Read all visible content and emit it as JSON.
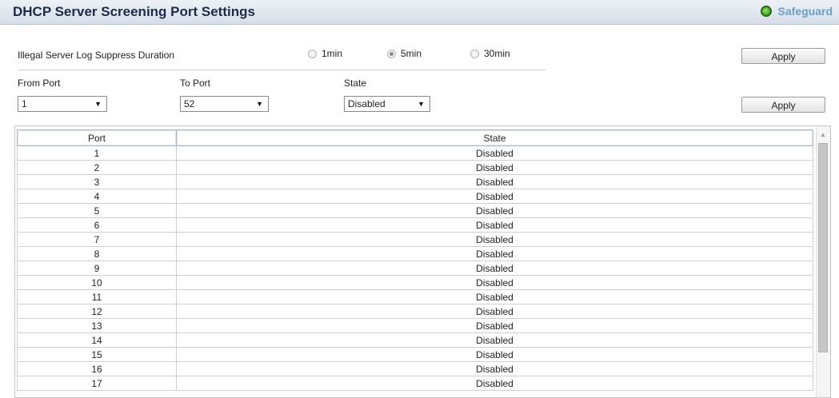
{
  "header": {
    "title": "DHCP Server Screening Port Settings",
    "safeguard_label": "Safeguard",
    "safeguard_icon": "status-dot-icon",
    "safeguard_color": "#2e8b12"
  },
  "suppress": {
    "label": "Illegal Server Log Suppress Duration",
    "options": [
      "1min",
      "5min",
      "30min"
    ],
    "selected": "5min",
    "apply_label": "Apply"
  },
  "port_form": {
    "from_label": "From Port",
    "to_label": "To Port",
    "state_label": "State",
    "from_value": "1",
    "to_value": "52",
    "state_value": "Disabled",
    "apply_label": "Apply"
  },
  "table": {
    "columns": [
      "Port",
      "State"
    ],
    "rows": [
      [
        "1",
        "Disabled"
      ],
      [
        "2",
        "Disabled"
      ],
      [
        "3",
        "Disabled"
      ],
      [
        "4",
        "Disabled"
      ],
      [
        "5",
        "Disabled"
      ],
      [
        "6",
        "Disabled"
      ],
      [
        "7",
        "Disabled"
      ],
      [
        "8",
        "Disabled"
      ],
      [
        "9",
        "Disabled"
      ],
      [
        "10",
        "Disabled"
      ],
      [
        "11",
        "Disabled"
      ],
      [
        "12",
        "Disabled"
      ],
      [
        "13",
        "Disabled"
      ],
      [
        "14",
        "Disabled"
      ],
      [
        "15",
        "Disabled"
      ],
      [
        "16",
        "Disabled"
      ],
      [
        "17",
        "Disabled"
      ]
    ]
  }
}
